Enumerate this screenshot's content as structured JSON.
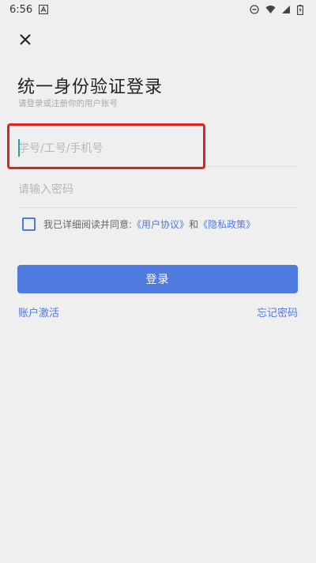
{
  "status_bar": {
    "time": "6:56"
  },
  "header": {
    "title": "统一身份验证登录",
    "subtitle": "请登录或注册你的用户账号"
  },
  "form": {
    "username_placeholder": "学号/工号/手机号",
    "username_value": "",
    "password_placeholder": "请输入密码",
    "password_value": ""
  },
  "agreement": {
    "prefix": "我已详细阅读并同意:",
    "user_agreement": "《用户协议》",
    "and": "和",
    "privacy_policy": "《隐私政策》",
    "checked": false
  },
  "actions": {
    "login_label": "登录",
    "activate_label": "账户激活",
    "forgot_label": "忘记密码"
  },
  "colors": {
    "accent": "#4f7ae0",
    "highlight": "#e52020",
    "cursor": "#1aa89a"
  }
}
